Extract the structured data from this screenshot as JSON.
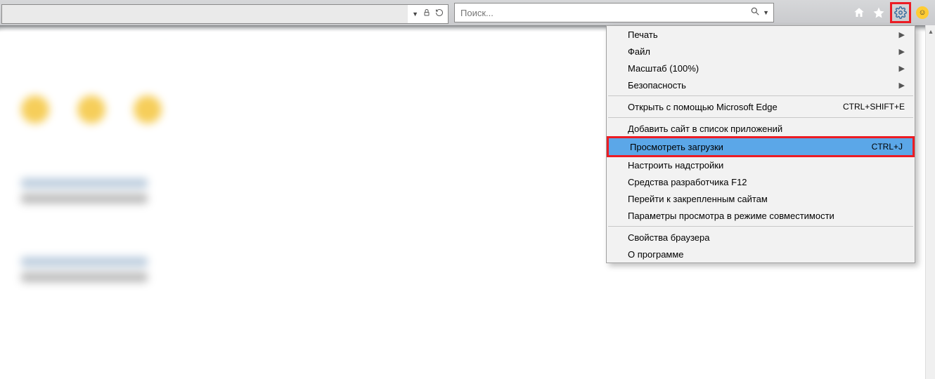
{
  "search": {
    "placeholder": "Поиск..."
  },
  "menu": {
    "section1": [
      {
        "label": "Печать",
        "submenu": true
      },
      {
        "label": "Файл",
        "submenu": true
      },
      {
        "label": "Масштаб (100%)",
        "submenu": true
      },
      {
        "label": "Безопасность",
        "submenu": true
      }
    ],
    "section2": [
      {
        "label": "Открыть с помощью Microsoft Edge",
        "shortcut": "CTRL+SHIFT+E"
      }
    ],
    "section3": [
      {
        "label": "Добавить сайт в список приложений"
      },
      {
        "label": "Просмотреть загрузки",
        "shortcut": "CTRL+J",
        "highlighted": true
      },
      {
        "label": "Настроить надстройки"
      },
      {
        "label": "Средства разработчика F12"
      },
      {
        "label": "Перейти к закрепленным сайтам"
      },
      {
        "label": "Параметры просмотра в режиме совместимости"
      }
    ],
    "section4": [
      {
        "label": "Свойства браузера"
      },
      {
        "label": "О программе"
      }
    ]
  }
}
